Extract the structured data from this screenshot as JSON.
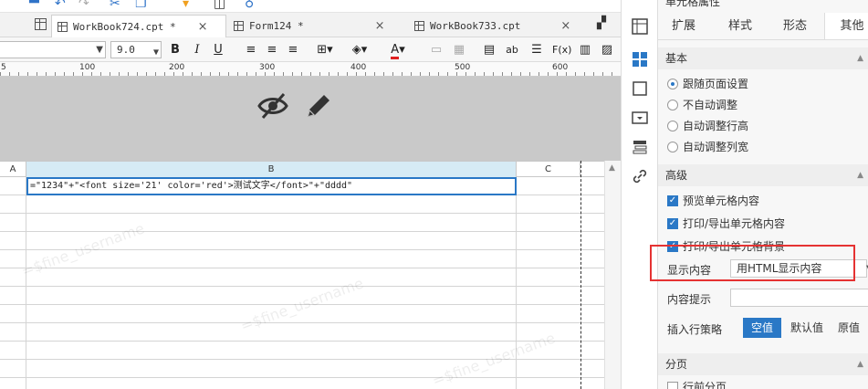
{
  "tabs": [
    {
      "label": "WorkBook724.cpt *",
      "close": "×",
      "active": true
    },
    {
      "label": "Form124 *",
      "close": "×",
      "active": false
    },
    {
      "label": "WorkBook733.cpt",
      "close": "×",
      "active": false
    }
  ],
  "toolbar": {
    "font_value": "",
    "font_size": "9.0",
    "bold": "B",
    "italic": "I",
    "underline": "U",
    "ab_label": "ab",
    "fx_label": "F(x)"
  },
  "ruler": {
    "marks": [
      "5",
      "100",
      "200",
      "300",
      "400",
      "500",
      "600"
    ]
  },
  "columns": {
    "a": "A",
    "b": "B",
    "c": "C"
  },
  "cell": {
    "formula": "=\"1234\"+\"<font size='21' color='red'>测试文字</font>\"+\"dddd\""
  },
  "watermark": "=$fine_username",
  "panel": {
    "title": "单元格属性",
    "tabs": [
      "扩展",
      "样式",
      "形态",
      "其他"
    ],
    "active_tab": "其他",
    "basic": {
      "title": "基本",
      "options": [
        "跟随页面设置",
        "不自动调整",
        "自动调整行高",
        "自动调整列宽"
      ],
      "selected": "跟随页面设置"
    },
    "advanced": {
      "title": "高级",
      "checks": [
        "预览单元格内容",
        "打印/导出单元格内容",
        "打印/导出单元格背景"
      ],
      "display_label": "显示内容",
      "display_value": "用HTML显示内容",
      "tooltip_label": "内容提示",
      "tooltip_value": "",
      "insert_label": "插入行策略",
      "insert_options": [
        "空值",
        "默认值",
        "原值"
      ],
      "insert_selected": "空值"
    },
    "paging": {
      "title": "分页",
      "row_check": "行前分页"
    }
  },
  "colors": {
    "accent": "#2a78c6",
    "highlight": "#e53232",
    "band": "#c9c9c9"
  }
}
